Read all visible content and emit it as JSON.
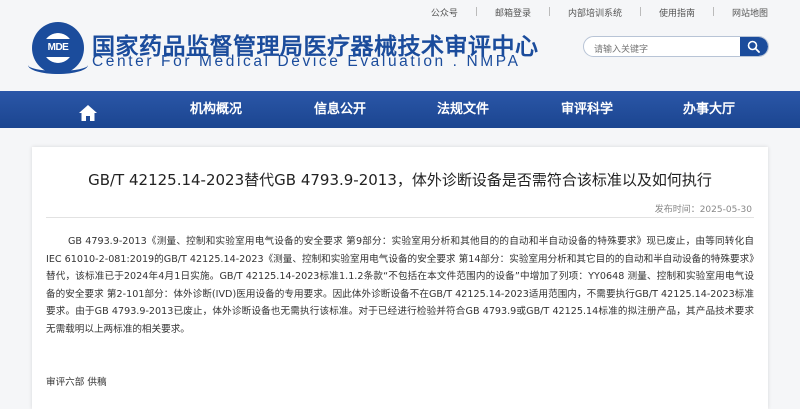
{
  "utility_links": [
    "公众号",
    "邮箱登录",
    "内部培训系统",
    "使用指南",
    "网站地图"
  ],
  "header": {
    "logo_text": "MDE",
    "site_name_cn": "国家药品监督管理局医疗器械技术审评中心",
    "site_name_en": "Center For Medical Device Evaluation . NMPA"
  },
  "search": {
    "placeholder": "请输入关键字",
    "icon": "search-icon"
  },
  "nav": {
    "home_icon": "home-icon",
    "items": [
      "机构概况",
      "信息公开",
      "法规文件",
      "审评科学",
      "办事大厅"
    ]
  },
  "article": {
    "title": "GB/T 42125.14-2023替代GB 4793.9-2013，体外诊断设备是否需符合该标准以及如何执行",
    "date": "发布时间：2025-05-30",
    "body": "GB 4793.9-2013《测量、控制和实验室用电气设备的安全要求 第9部分：实验室用分析和其他目的的自动和半自动设备的特殊要求》现已废止，由等同转化自IEC 61010-2-081:2019的GB/T 42125.14-2023《测量、控制和实验室用电气设备的安全要求 第14部分：实验室用分析和其它目的的自动和半自动设备的特殊要求》替代，该标准已于2024年4月1日实施。GB/T 42125.14-2023标准1.1.2条款“不包括在本文件范围内的设备”中增加了列项：YY0648 测量、控制和实验室用电气设备的安全要求 第2-101部分：体外诊断(IVD)医用设备的专用要求。因此体外诊断设备不在GB/T 42125.14-2023适用范围内，不需要执行GB/T 42125.14-2023标准要求。由于GB 4793.9-2013已废止，体外诊断设备也无需执行该标准。对于已经进行检验并符合GB 4793.9或GB/T 42125.14标准的拟注册产品，其产品技术要求无需载明以上两标准的相关要求。",
    "signoff": "审评六部 供稿"
  },
  "colors": {
    "brand_blue": "#1b4c9c",
    "nav_blue": "#1f4a9a"
  }
}
